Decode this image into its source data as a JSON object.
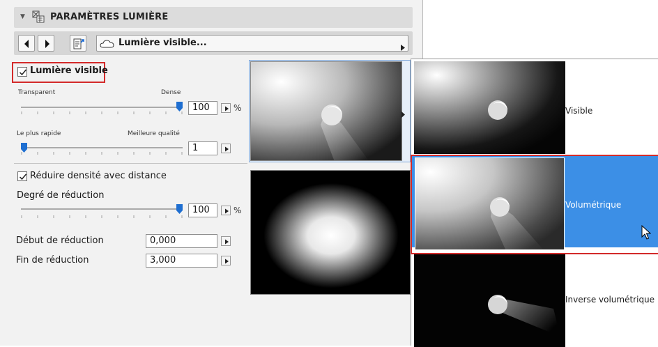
{
  "header": {
    "title": "PARAMÈTRES LUMIÈRE"
  },
  "nav": {
    "preset_label": "Lumière visible..."
  },
  "visible_section": {
    "checkbox_label": "Lumière visible",
    "checked": true,
    "density": {
      "left_label": "Transparent",
      "right_label": "Dense",
      "value": "100",
      "unit": "%",
      "slider_fraction": 1.0
    },
    "quality": {
      "left_label": "Le plus rapide",
      "right_label": "Meilleure qualité",
      "value": "1",
      "slider_fraction": 0.0
    }
  },
  "reduction_section": {
    "checkbox_label": "Réduire densité avec distance",
    "checked": true,
    "degree": {
      "label": "Degré de réduction",
      "value": "100",
      "unit": "%",
      "slider_fraction": 1.0
    },
    "start": {
      "label": "Début de réduction",
      "value": "0,000"
    },
    "end": {
      "label": "Fin de réduction",
      "value": "3,000"
    }
  },
  "popup": {
    "options": [
      {
        "label": "Visible",
        "selected": false
      },
      {
        "label": "Volumétrique",
        "selected": true
      },
      {
        "label": "Inverse volumétrique",
        "selected": false
      }
    ]
  },
  "colors": {
    "selection": "#3c8fe6",
    "highlight_outline": "#d32a2a",
    "slider_thumb": "#1f6fd1"
  }
}
